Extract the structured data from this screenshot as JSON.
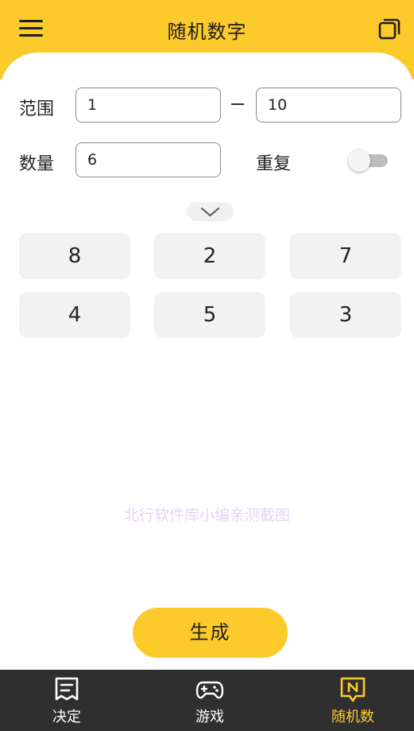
{
  "header": {
    "title": "随机数字",
    "menu_icon": "menu-icon",
    "copy_icon": "copy-icon",
    "accent": "#fdca2b"
  },
  "range": {
    "label": "范围",
    "min_value": "1",
    "separator": "–",
    "max_value": "10"
  },
  "count": {
    "label": "数量",
    "value": "6"
  },
  "repeat": {
    "label": "重复",
    "enabled": false
  },
  "expand_icon": "chevron-down-icon",
  "results": [
    "8",
    "2",
    "7",
    "4",
    "5",
    "3"
  ],
  "watermark": "北行软件库小编亲测截图",
  "generate_label": "生成",
  "bottom_nav": {
    "items": [
      {
        "label": "决定",
        "icon": "decide-note-icon",
        "active": false
      },
      {
        "label": "游戏",
        "icon": "gamepad-icon",
        "active": false
      },
      {
        "label": "随机数",
        "icon": "random-number-icon",
        "active": true
      }
    ],
    "active_color": "#fdca2b"
  }
}
